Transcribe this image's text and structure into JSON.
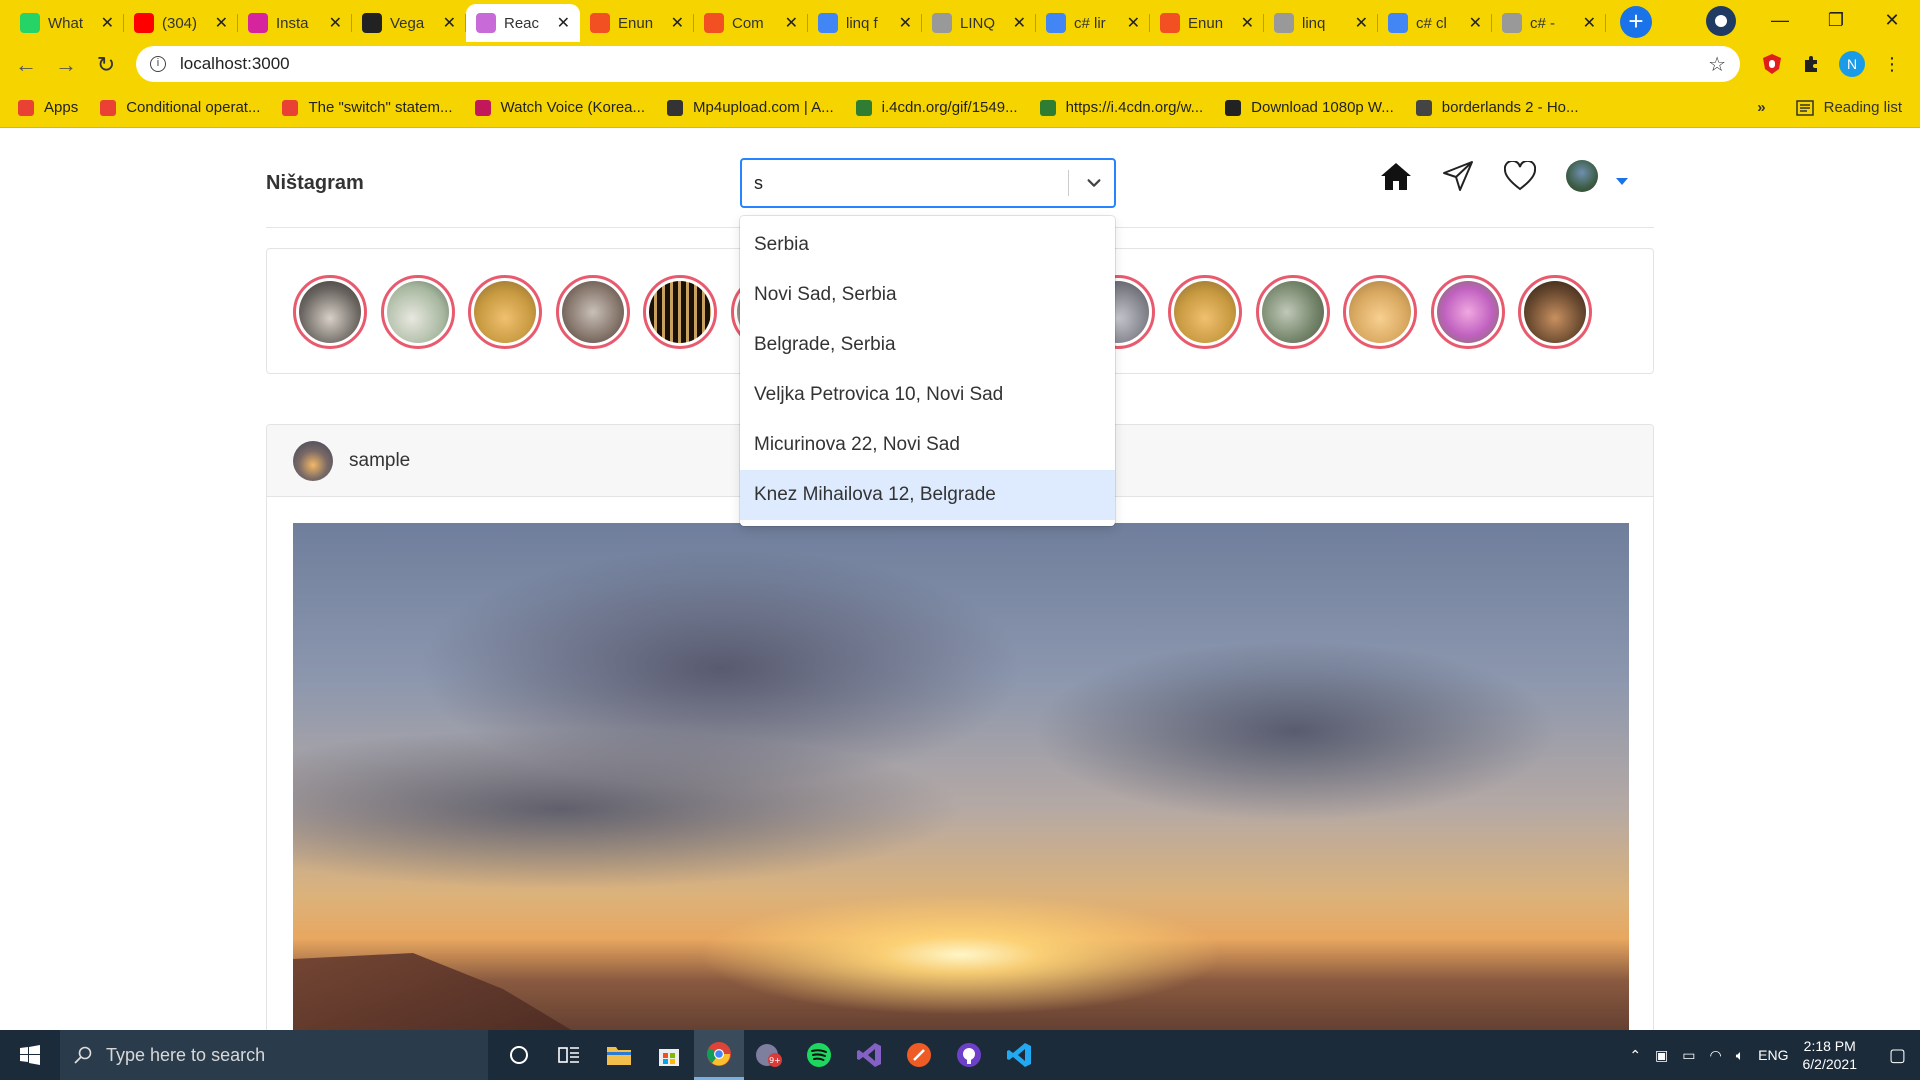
{
  "browser": {
    "tabs": [
      {
        "label": "What",
        "icon": "whatsapp-icon",
        "color": "#25d366"
      },
      {
        "label": "(304)",
        "icon": "youtube-icon",
        "color": "#ff0000"
      },
      {
        "label": "Insta",
        "icon": "instagram-icon",
        "color": "#d6249f"
      },
      {
        "label": "Vega",
        "icon": "github-icon",
        "color": "#222222"
      },
      {
        "label": "Reac",
        "icon": "react-icon",
        "color": "#c86bd8"
      },
      {
        "label": "Enun",
        "icon": "microsoft-icon",
        "color": "#f25022"
      },
      {
        "label": "Com",
        "icon": "microsoft-icon",
        "color": "#f25022"
      },
      {
        "label": "linq f",
        "icon": "google-icon",
        "color": "#4285f4"
      },
      {
        "label": "LINQ",
        "icon": "stackoverflow-icon",
        "color": "#999999"
      },
      {
        "label": "c# lir",
        "icon": "google-icon",
        "color": "#4285f4"
      },
      {
        "label": "Enun",
        "icon": "microsoft-icon",
        "color": "#f25022"
      },
      {
        "label": "linq",
        "icon": "stackoverflow-icon",
        "color": "#999999"
      },
      {
        "label": "c# cl",
        "icon": "google-icon",
        "color": "#4285f4"
      },
      {
        "label": "c# -",
        "icon": "stackoverflow-icon",
        "color": "#999999"
      }
    ],
    "active_tab_index": 4,
    "url": "localhost:3000",
    "bookmarks": [
      {
        "label": "Apps",
        "icon": "apps-grid-icon",
        "color": "#e94235"
      },
      {
        "label": "Conditional operat...",
        "icon": "bookmark-favicon",
        "color": "#e94235"
      },
      {
        "label": "The \"switch\" statem...",
        "icon": "bookmark-favicon",
        "color": "#e94235"
      },
      {
        "label": "Watch Voice (Korea...",
        "icon": "bookmark-favicon",
        "color": "#c2185b"
      },
      {
        "label": "Mp4upload.com | A...",
        "icon": "bookmark-favicon",
        "color": "#333333"
      },
      {
        "label": "i.4cdn.org/gif/1549...",
        "icon": "bookmark-favicon",
        "color": "#2e7d32"
      },
      {
        "label": "https://i.4cdn.org/w...",
        "icon": "bookmark-favicon",
        "color": "#2e7d32"
      },
      {
        "label": "Download 1080p W...",
        "icon": "bookmark-favicon",
        "color": "#222222"
      },
      {
        "label": "borderlands 2 - Ho...",
        "icon": "bookmark-favicon",
        "color": "#444444"
      }
    ],
    "bookmarks_overflow": "»",
    "reading_list": "Reading list"
  },
  "app": {
    "brand": "Ništagram",
    "search": {
      "value": "s"
    },
    "dropdown_options": [
      "Serbia",
      "Novi Sad, Serbia",
      "Belgrade, Serbia",
      "Veljka Petrovica 10, Novi Sad",
      "Micurinova 22, Novi Sad",
      "Knez Mihailova 12, Belgrade"
    ],
    "focused_option_index": 5,
    "stories_count": 15,
    "post": {
      "username": "sample"
    }
  },
  "taskbar": {
    "search_placeholder": "Type here to search",
    "language": "ENG",
    "time": "2:18 PM",
    "date": "6/2/2021"
  }
}
